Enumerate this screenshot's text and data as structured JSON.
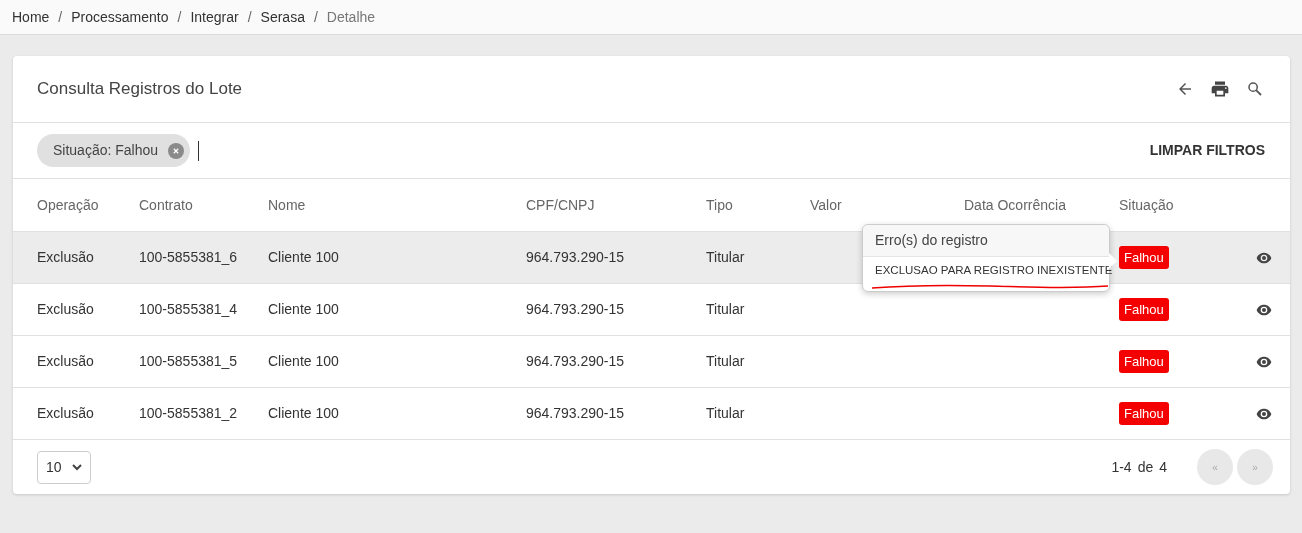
{
  "breadcrumb": [
    {
      "label": "Home",
      "current": false
    },
    {
      "label": "Processamento",
      "current": false
    },
    {
      "label": "Integrar",
      "current": false
    },
    {
      "label": "Serasa",
      "current": false
    },
    {
      "label": "Detalhe",
      "current": true
    }
  ],
  "breadcrumb_separator": "/",
  "card": {
    "title": "Consulta Registros do Lote"
  },
  "filters": [
    {
      "label": "Situação: Falhou"
    }
  ],
  "clear_filters": "LIMPAR FILTROS",
  "table": {
    "columns": [
      "Operação",
      "Contrato",
      "Nome",
      "CPF/CNPJ",
      "Tipo",
      "Valor",
      "Data Ocorrência",
      "Situação"
    ],
    "rows": [
      {
        "operacao": "Exclusão",
        "contrato": "100-5855381_6",
        "nome": "Cliente 100",
        "cpf": "964.793.290-15",
        "tipo": "Titular",
        "situacao": "Falhou",
        "highlighted": true
      },
      {
        "operacao": "Exclusão",
        "contrato": "100-5855381_4",
        "nome": "Cliente 100",
        "cpf": "964.793.290-15",
        "tipo": "Titular",
        "situacao": "Falhou",
        "highlighted": false
      },
      {
        "operacao": "Exclusão",
        "contrato": "100-5855381_5",
        "nome": "Cliente 100",
        "cpf": "964.793.290-15",
        "tipo": "Titular",
        "situacao": "Falhou",
        "highlighted": false
      },
      {
        "operacao": "Exclusão",
        "contrato": "100-5855381_2",
        "nome": "Cliente 100",
        "cpf": "964.793.290-15",
        "tipo": "Titular",
        "situacao": "Falhou",
        "highlighted": false
      }
    ]
  },
  "tooltip": {
    "title": "Erro(s) do registro",
    "message": "EXCLUSAO PARA REGISTRO INEXISTENTE"
  },
  "page_size": "10",
  "pagination": {
    "range": "1-4",
    "of": "de",
    "total": "4",
    "prev": "«",
    "next": "»",
    "prev_disabled": true,
    "next_disabled": true
  }
}
